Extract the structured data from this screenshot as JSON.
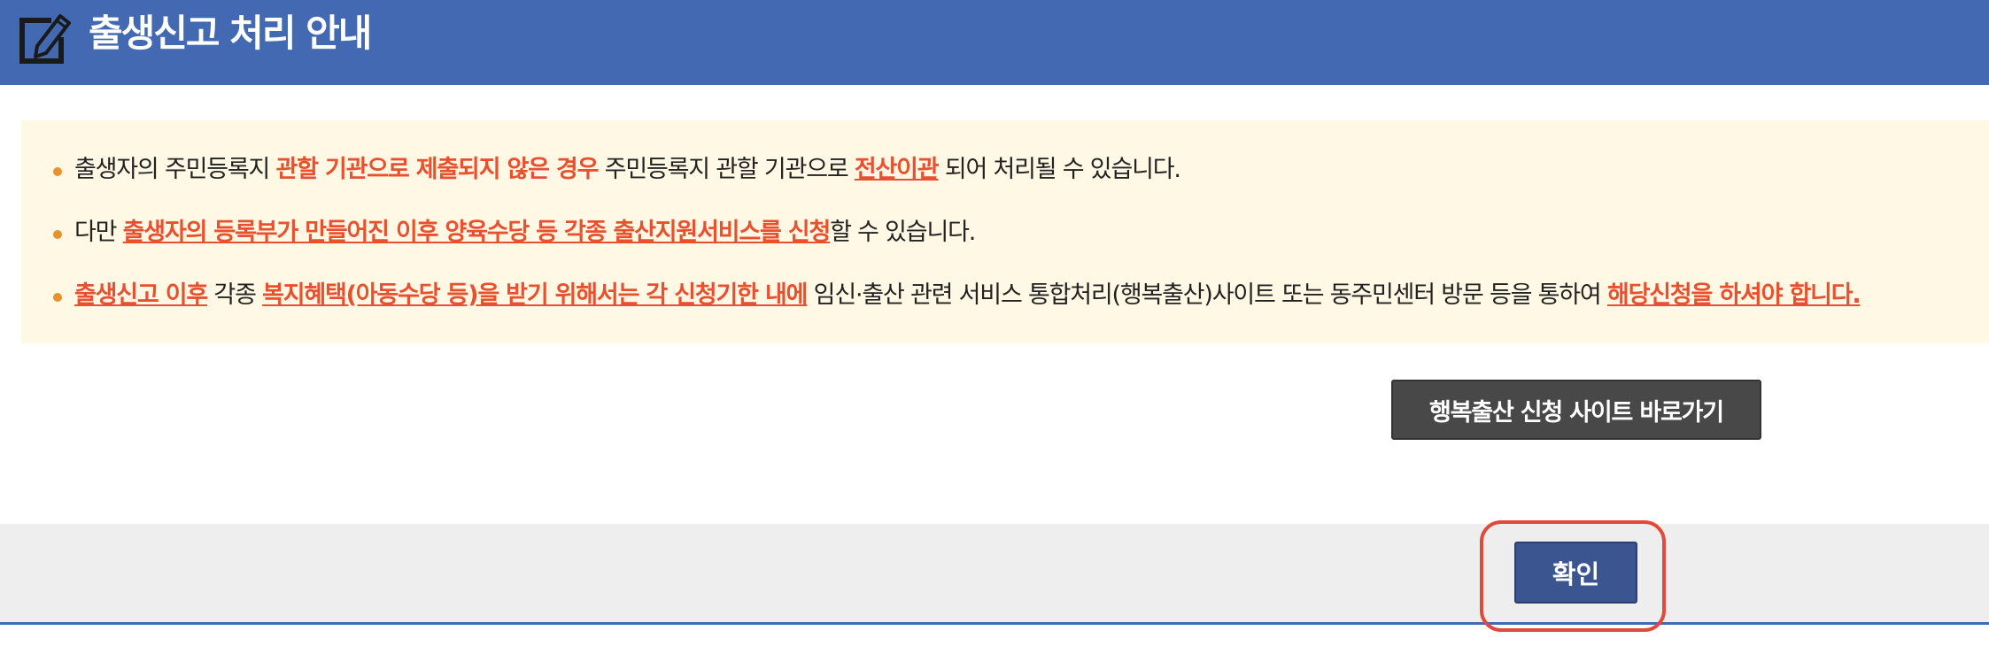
{
  "header": {
    "title": "출생신고 처리 안내",
    "icon": "edit-icon"
  },
  "notice": {
    "items": [
      {
        "parts": [
          {
            "text": "출생자의 주민등록지 ",
            "style": "normal"
          },
          {
            "text": "관할 기관으로 제출되지 않은 경우",
            "style": "highlight"
          },
          {
            "text": " 주민등록지 관할 기관으로 ",
            "style": "normal"
          },
          {
            "text": "전산이관",
            "style": "highlight-underline"
          },
          {
            "text": " 되어 처리될 수 있습니다.",
            "style": "normal"
          }
        ]
      },
      {
        "parts": [
          {
            "text": "다만 ",
            "style": "normal"
          },
          {
            "text": "출생자의 등록부가 만들어진 이후 양육수당 등 각종 출산지원서비스를 신청",
            "style": "highlight-underline"
          },
          {
            "text": "할 수 있습니다.",
            "style": "normal"
          }
        ]
      },
      {
        "parts": [
          {
            "text": "출생신고 이후",
            "style": "highlight-underline"
          },
          {
            "text": " 각종 ",
            "style": "normal"
          },
          {
            "text": "복지혜택(아동수당 등)을 받기 위해서는 각 신청기한 내에",
            "style": "highlight-underline"
          },
          {
            "text": " 임신·출산 관련 서비스 통합처리(행복출산)사이트 또는 동주민센터 방문 등을 통하여 ",
            "style": "normal"
          },
          {
            "text": "해당신청을 하셔야 합니다.",
            "style": "highlight-underline"
          }
        ]
      }
    ]
  },
  "buttons": {
    "site_link_label": "행복출산 신청 사이트 바로가기",
    "confirm_label": "확인"
  },
  "colors": {
    "header_bg": "#4369b3",
    "notice_bg": "#fff8e5",
    "highlight": "#e8502e",
    "bullet": "#e8922e",
    "site_button_bg": "#484848",
    "confirm_button_bg": "#3b5591",
    "focus_ring": "#e04a3a"
  }
}
